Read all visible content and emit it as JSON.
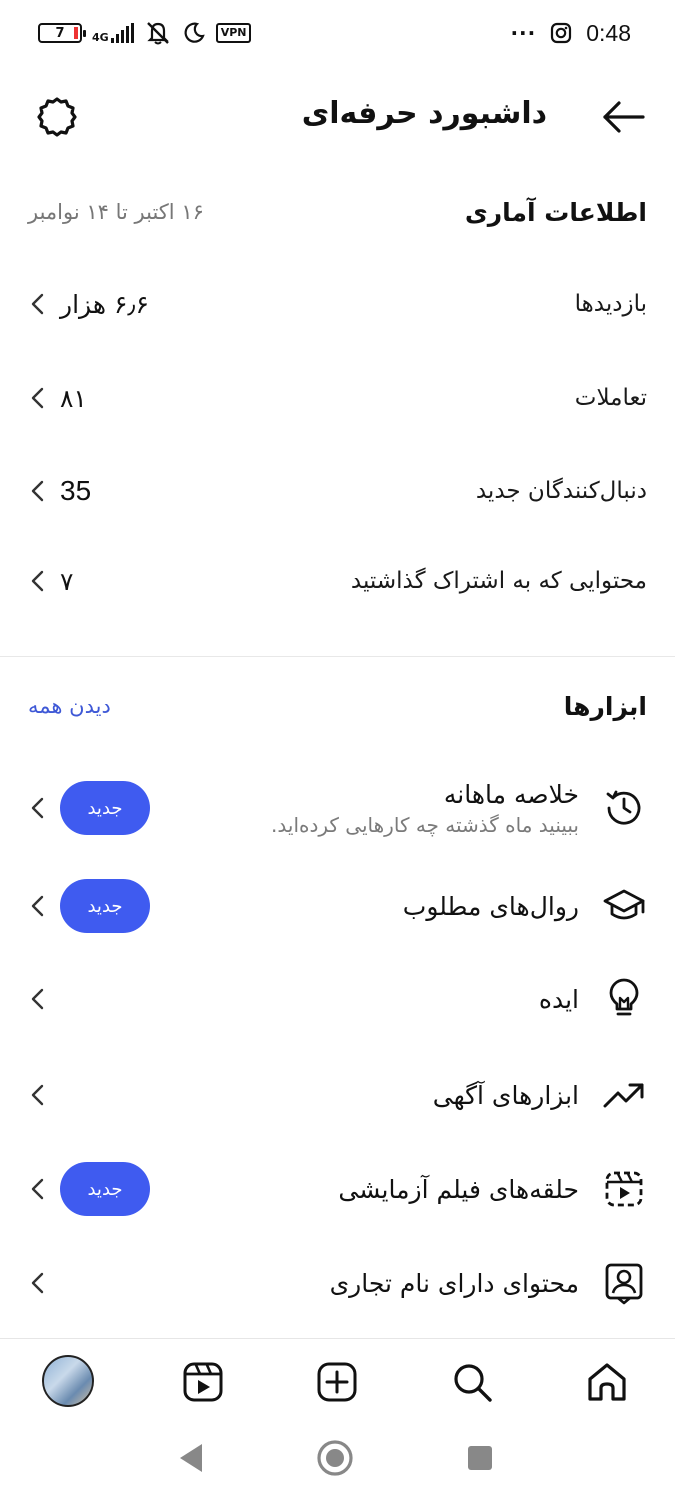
{
  "status_bar": {
    "battery": "7",
    "network": "4G",
    "vpn": "VPN",
    "more": "···",
    "time": "0:48"
  },
  "header": {
    "title": "داشبورد حرفه‌ای"
  },
  "stats": {
    "title": "اطلاعات آماری",
    "date_range": "۱۶ اکتبر تا ۱۴ نوامبر",
    "rows": [
      {
        "label": "بازدیدها",
        "value": "۶٫۶ هزار"
      },
      {
        "label": "تعاملات",
        "value": "۸۱"
      },
      {
        "label": "دنبال‌کنندگان جدید",
        "value": "35"
      },
      {
        "label": "محتوایی که به اشتراک گذاشتید",
        "value": "۷"
      }
    ]
  },
  "tools": {
    "title": "ابزارها",
    "see_all": "دیدن همه",
    "items": [
      {
        "label": "خلاصه ماهانه",
        "desc": "ببینید ماه گذشته چه کارهایی کرده‌اید.",
        "badge": "جدید",
        "icon": "history-clock-icon"
      },
      {
        "label": "روال‌های مطلوب",
        "badge": "جدید",
        "icon": "graduation-cap-icon"
      },
      {
        "label": "ایده",
        "icon": "lightbulb-icon"
      },
      {
        "label": "ابزارهای آگهی",
        "icon": "trending-up-icon"
      },
      {
        "label": "حلقه‌های فیلم آزمایشی",
        "badge": "جدید",
        "icon": "trial-reels-icon"
      },
      {
        "label": "محتوای دارای نام تجاری",
        "icon": "branded-content-icon"
      }
    ]
  },
  "colors": {
    "accent": "#3f5bf0",
    "link": "#3e58d6"
  }
}
